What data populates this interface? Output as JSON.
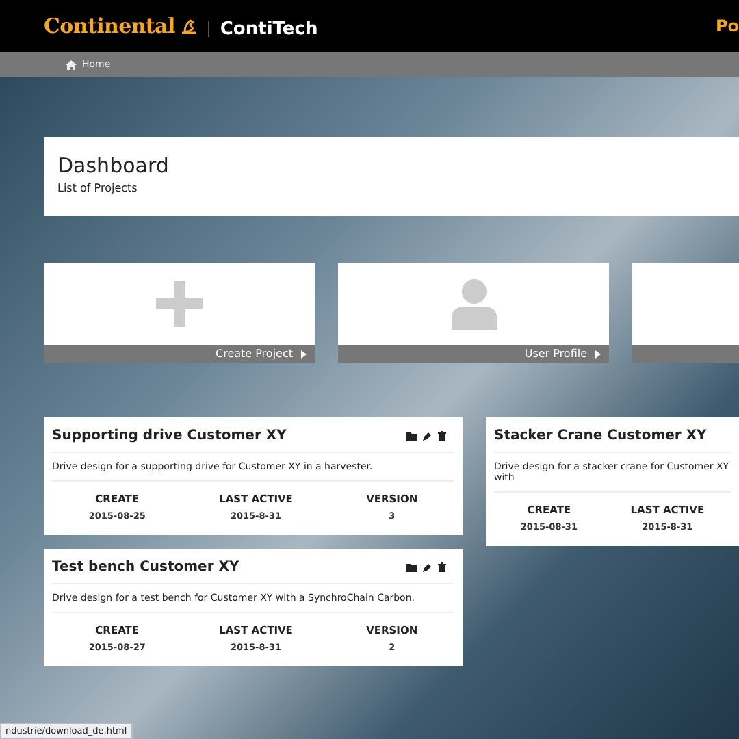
{
  "header": {
    "brand": "Continental",
    "product": "ContiTech",
    "nav_partial": "Po"
  },
  "breadcrumb": {
    "items": [
      "Home"
    ]
  },
  "dashboard": {
    "title": "Dashboard",
    "subtitle": "List of Projects"
  },
  "tiles": [
    {
      "kind": "create",
      "label": "Create Project"
    },
    {
      "kind": "profile",
      "label": "User Profile"
    },
    {
      "kind": "blank"
    }
  ],
  "projects": [
    {
      "title": "Supporting drive Customer XY",
      "description": "Drive design for a supporting drive for Customer XY in a harvester.",
      "actions": true,
      "stats": [
        {
          "label": "CREATE",
          "value": "2015-08-25"
        },
        {
          "label": "LAST ACTIVE",
          "value": "2015-8-31"
        },
        {
          "label": "VERSION",
          "value": "3"
        }
      ]
    },
    {
      "title": "Stacker Crane Customer XY",
      "description": "Drive design for a stacker crane for Customer XY with",
      "actions": false,
      "stats": [
        {
          "label": "CREATE",
          "value": "2015-08-31"
        },
        {
          "label": "LAST ACTIVE",
          "value": "2015-8-31"
        }
      ]
    },
    {
      "title": "Test bench Customer XY",
      "description": "Drive design for a test bench for Customer XY with a SynchroChain Carbon.",
      "actions": true,
      "stats": [
        {
          "label": "CREATE",
          "value": "2015-08-27"
        },
        {
          "label": "LAST ACTIVE",
          "value": "2015-8-31"
        },
        {
          "label": "VERSION",
          "value": "2"
        }
      ]
    }
  ],
  "status_bar": {
    "url": "ndustrie/download_de.html"
  }
}
